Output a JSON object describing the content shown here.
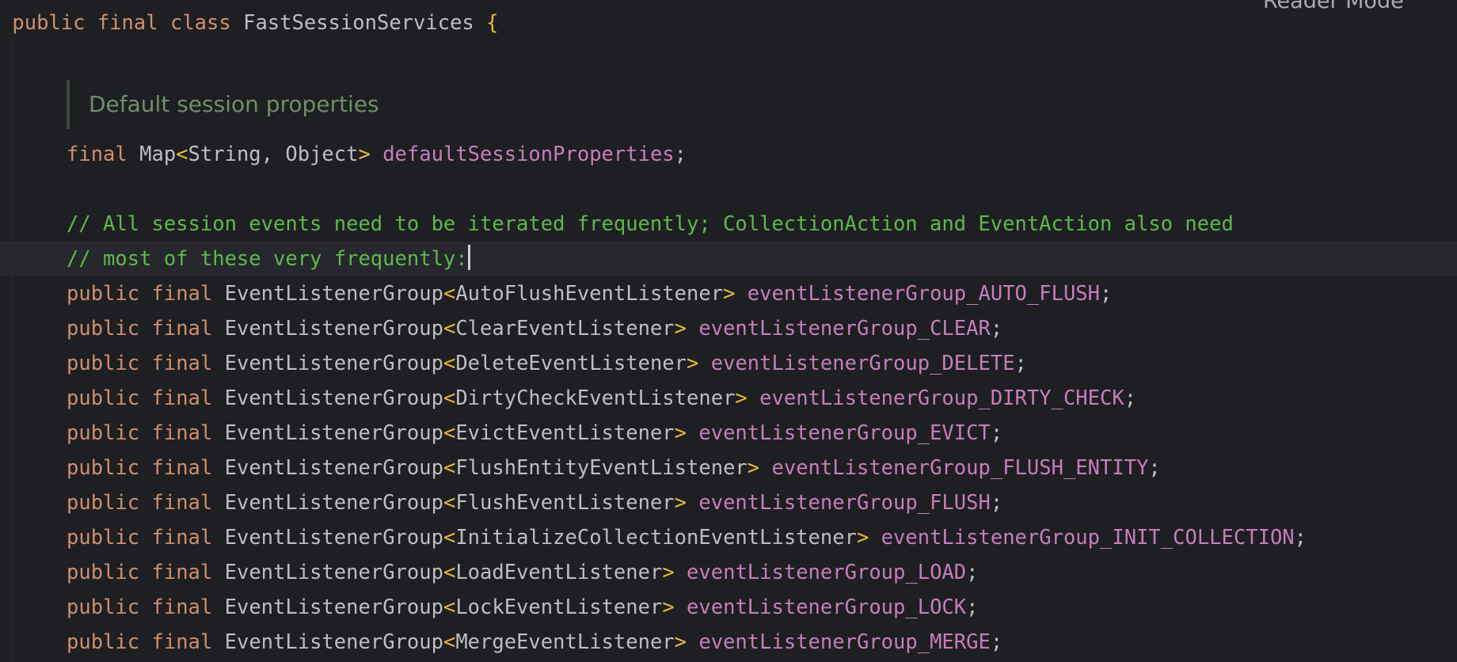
{
  "reader_mode": {
    "label": "Reader Mode"
  },
  "code": {
    "class_decl": {
      "k1": "public",
      "k2": "final",
      "k3": "class",
      "name": "FastSessionServices",
      "brace": "{"
    },
    "doc_comment": "Default session properties",
    "field1": {
      "kw": "final",
      "t1": "Map",
      "lt": "<",
      "t2": "String, Object",
      "gt": ">",
      "name": "defaultSessionProperties",
      "semi": ";"
    },
    "comment1": "// All session events need to be iterated frequently; CollectionAction and EventAction also need",
    "comment2": "// most of these very frequently:",
    "fields": [
      {
        "k1": "public",
        "k2": "final",
        "type": "EventListenerGroup",
        "lt": "<",
        "generic": "AutoFlushEventListener",
        "gt": ">",
        "name": "eventListenerGroup_AUTO_FLUSH",
        "semi": ";"
      },
      {
        "k1": "public",
        "k2": "final",
        "type": "EventListenerGroup",
        "lt": "<",
        "generic": "ClearEventListener",
        "gt": ">",
        "name": "eventListenerGroup_CLEAR",
        "semi": ";"
      },
      {
        "k1": "public",
        "k2": "final",
        "type": "EventListenerGroup",
        "lt": "<",
        "generic": "DeleteEventListener",
        "gt": ">",
        "name": "eventListenerGroup_DELETE",
        "semi": ";"
      },
      {
        "k1": "public",
        "k2": "final",
        "type": "EventListenerGroup",
        "lt": "<",
        "generic": "DirtyCheckEventListener",
        "gt": ">",
        "name": "eventListenerGroup_DIRTY_CHECK",
        "semi": ";"
      },
      {
        "k1": "public",
        "k2": "final",
        "type": "EventListenerGroup",
        "lt": "<",
        "generic": "EvictEventListener",
        "gt": ">",
        "name": "eventListenerGroup_EVICT",
        "semi": ";"
      },
      {
        "k1": "public",
        "k2": "final",
        "type": "EventListenerGroup",
        "lt": "<",
        "generic": "FlushEntityEventListener",
        "gt": ">",
        "name": "eventListenerGroup_FLUSH_ENTITY",
        "semi": ";"
      },
      {
        "k1": "public",
        "k2": "final",
        "type": "EventListenerGroup",
        "lt": "<",
        "generic": "FlushEventListener",
        "gt": ">",
        "name": "eventListenerGroup_FLUSH",
        "semi": ";"
      },
      {
        "k1": "public",
        "k2": "final",
        "type": "EventListenerGroup",
        "lt": "<",
        "generic": "InitializeCollectionEventListener",
        "gt": ">",
        "name": "eventListenerGroup_INIT_COLLECTION",
        "semi": ";"
      },
      {
        "k1": "public",
        "k2": "final",
        "type": "EventListenerGroup",
        "lt": "<",
        "generic": "LoadEventListener",
        "gt": ">",
        "name": "eventListenerGroup_LOAD",
        "semi": ";"
      },
      {
        "k1": "public",
        "k2": "final",
        "type": "EventListenerGroup",
        "lt": "<",
        "generic": "LockEventListener",
        "gt": ">",
        "name": "eventListenerGroup_LOCK",
        "semi": ";"
      },
      {
        "k1": "public",
        "k2": "final",
        "type": "EventListenerGroup",
        "lt": "<",
        "generic": "MergeEventListener",
        "gt": ">",
        "name": "eventListenerGroup_MERGE",
        "semi": ";"
      }
    ]
  },
  "colors": {
    "background": "#1e1f22",
    "keyword": "#cf8e6d",
    "field": "#c77dbb",
    "comment": "#5fb84c",
    "angle_bracket": "#e8ba36",
    "doc_comment": "#6f8e6a",
    "text": "#bcbec4"
  }
}
